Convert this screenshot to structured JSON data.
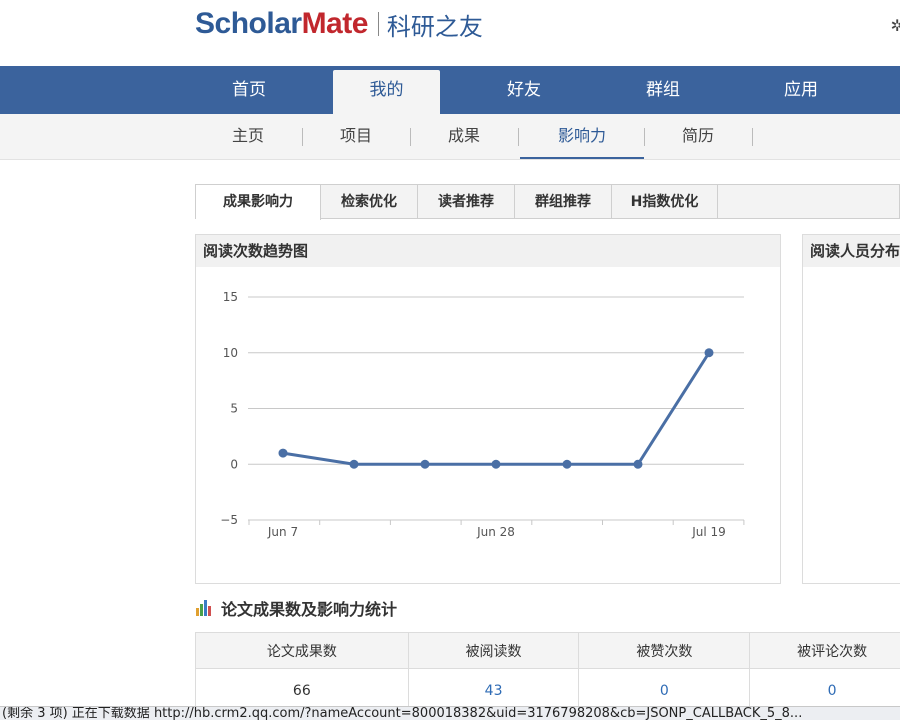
{
  "logo": {
    "english_part1": "Sch",
    "english_o": "o",
    "english_part2": "lar",
    "english_part3": "Mate",
    "chinese": "科研之友",
    "brand_blue": "#2e5a96",
    "brand_red": "#c1272d"
  },
  "main_nav": {
    "items": [
      {
        "label": "首页"
      },
      {
        "label": "我的",
        "active": true
      },
      {
        "label": "好友"
      },
      {
        "label": "群组"
      },
      {
        "label": "应用"
      }
    ]
  },
  "sub_nav": {
    "items": [
      {
        "label": "主页"
      },
      {
        "label": "项目"
      },
      {
        "label": "成果"
      },
      {
        "label": "影响力",
        "active": true
      },
      {
        "label": "简历"
      }
    ]
  },
  "tabs": [
    {
      "label": "成果影响力",
      "active": true
    },
    {
      "label": "检索优化"
    },
    {
      "label": "读者推荐"
    },
    {
      "label": "群组推荐"
    },
    {
      "label": "H指数优化"
    }
  ],
  "reading_trend": {
    "title": "阅读次数趋势图",
    "chart_data": {
      "type": "line",
      "y_ticks": [
        "15",
        "10",
        "5",
        "0",
        "−5"
      ],
      "x_tick_labels": [
        "Jun 7",
        "Jun 28",
        "Jul 19"
      ],
      "ylim": [
        -5,
        15
      ],
      "grid": true,
      "line_color": "#4a6fa5",
      "series": [
        {
          "values": [
            1,
            0,
            0,
            0,
            0,
            0,
            10
          ]
        }
      ]
    }
  },
  "reader_distribution": {
    "title": "阅读人员分布"
  },
  "stats": {
    "title": "论文成果数及影响力统计",
    "icon": "bar-chart-icon",
    "headers": [
      "论文成果数",
      "被阅读数",
      "被赞次数",
      "被评论次数"
    ],
    "values": [
      "66",
      "43",
      "0",
      "0"
    ]
  },
  "status_bar": {
    "text": "(剩余 3 项) 正在下载数据 http://hb.crm2.qq.com/?nameAccount=800018382&uid=3176798208&cb=JSONP_CALLBACK_5_8..."
  }
}
